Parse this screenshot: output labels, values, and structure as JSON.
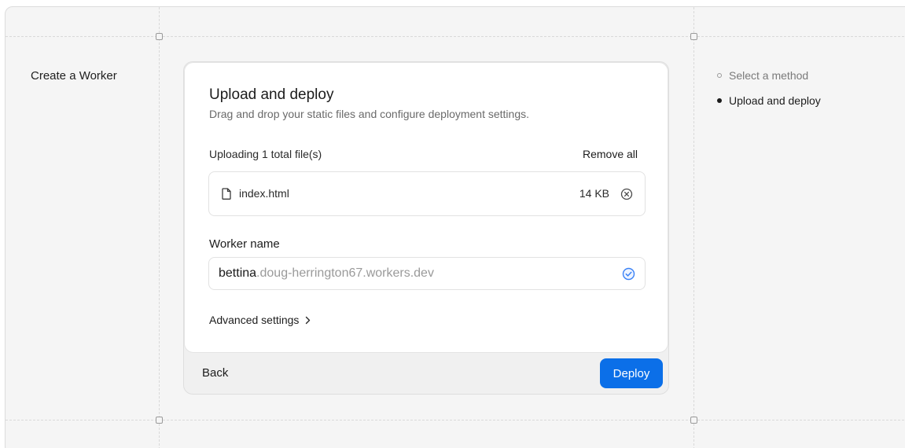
{
  "page": {
    "title": "Create a Worker"
  },
  "card": {
    "title": "Upload and deploy",
    "subtitle": "Drag and drop your static files and configure deployment settings."
  },
  "upload": {
    "count_label": "Uploading 1 total file(s)",
    "remove_all_label": "Remove all",
    "files": [
      {
        "name": "index.html",
        "size": "14 KB",
        "icon": "file-icon"
      }
    ]
  },
  "worker_name": {
    "label": "Worker name",
    "value": "bettina",
    "suffix": ".doug-herrington67.workers.dev",
    "status_icon": "check-circle-icon"
  },
  "advanced": {
    "label": "Advanced settings",
    "icon": "chevron-right-icon"
  },
  "footer": {
    "back_label": "Back",
    "deploy_label": "Deploy"
  },
  "steps": [
    {
      "label": "Select a method",
      "state": "inactive"
    },
    {
      "label": "Upload and deploy",
      "state": "active"
    }
  ],
  "colors": {
    "accent": "#0b6fe8",
    "check": "#3b82f6"
  }
}
